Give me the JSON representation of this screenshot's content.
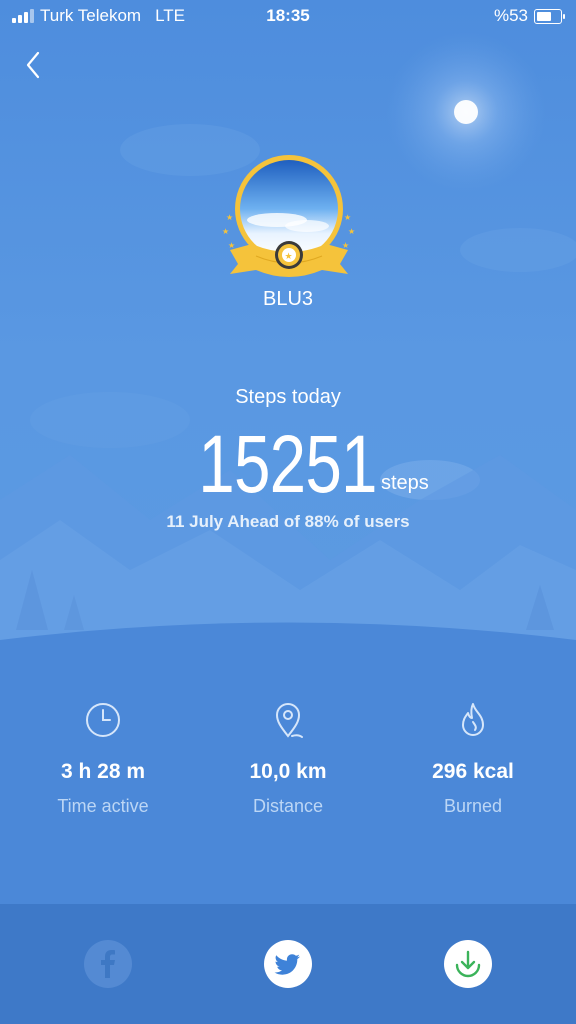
{
  "status_bar": {
    "carrier": "Turk Telekom",
    "network": "LTE",
    "time": "18:35",
    "battery_text": "%53",
    "battery_level": 0.53
  },
  "profile": {
    "name": "BLU3",
    "badge_icon": "award-medal-icon"
  },
  "steps": {
    "label": "Steps today",
    "count": "15251",
    "unit": "steps",
    "summary": "11 July Ahead of 88% of users"
  },
  "stats": [
    {
      "icon": "clock-icon",
      "value": "3 h 28 m",
      "label": "Time active"
    },
    {
      "icon": "location-pin-icon",
      "value": "10,0 km",
      "label": "Distance"
    },
    {
      "icon": "flame-icon",
      "value": "296 kcal",
      "label": "Burned"
    }
  ],
  "share": {
    "facebook_icon": "facebook-icon",
    "twitter_icon": "twitter-icon",
    "download_icon": "download-icon"
  },
  "colors": {
    "background": "#4f8fdc",
    "bottom_bar": "#3e79c8",
    "badge_gold": "#f5c33b",
    "download_green": "#3bb35a",
    "twitter_blue": "#3e82d8"
  }
}
